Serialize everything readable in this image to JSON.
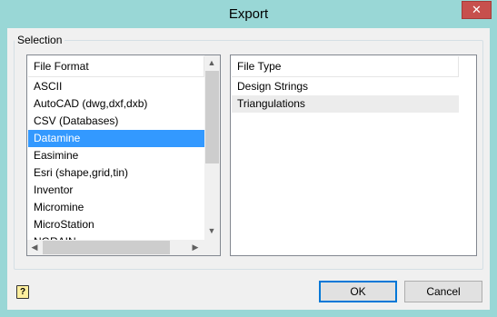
{
  "window": {
    "title": "Export",
    "close_glyph": "✕"
  },
  "selection": {
    "group_label": "Selection",
    "file_format": {
      "header": "File Format",
      "items": [
        "ASCII",
        "AutoCAD (dwg,dxf,dxb)",
        "CSV (Databases)",
        "Datamine",
        "Easimine",
        "Esri (shape,grid,tin)",
        "Inventor",
        "Micromine",
        "MicroStation",
        "NGRAIN"
      ],
      "selected": "Datamine"
    },
    "file_type": {
      "header": "File Type",
      "items": [
        "Design Strings",
        "Triangulations"
      ],
      "highlighted": "Triangulations"
    }
  },
  "buttons": {
    "ok": "OK",
    "cancel": "Cancel"
  },
  "help": {
    "glyph": "?"
  },
  "colors": {
    "title_bar": "#99d7d6",
    "selection": "#3399ff",
    "close": "#c7504d"
  }
}
